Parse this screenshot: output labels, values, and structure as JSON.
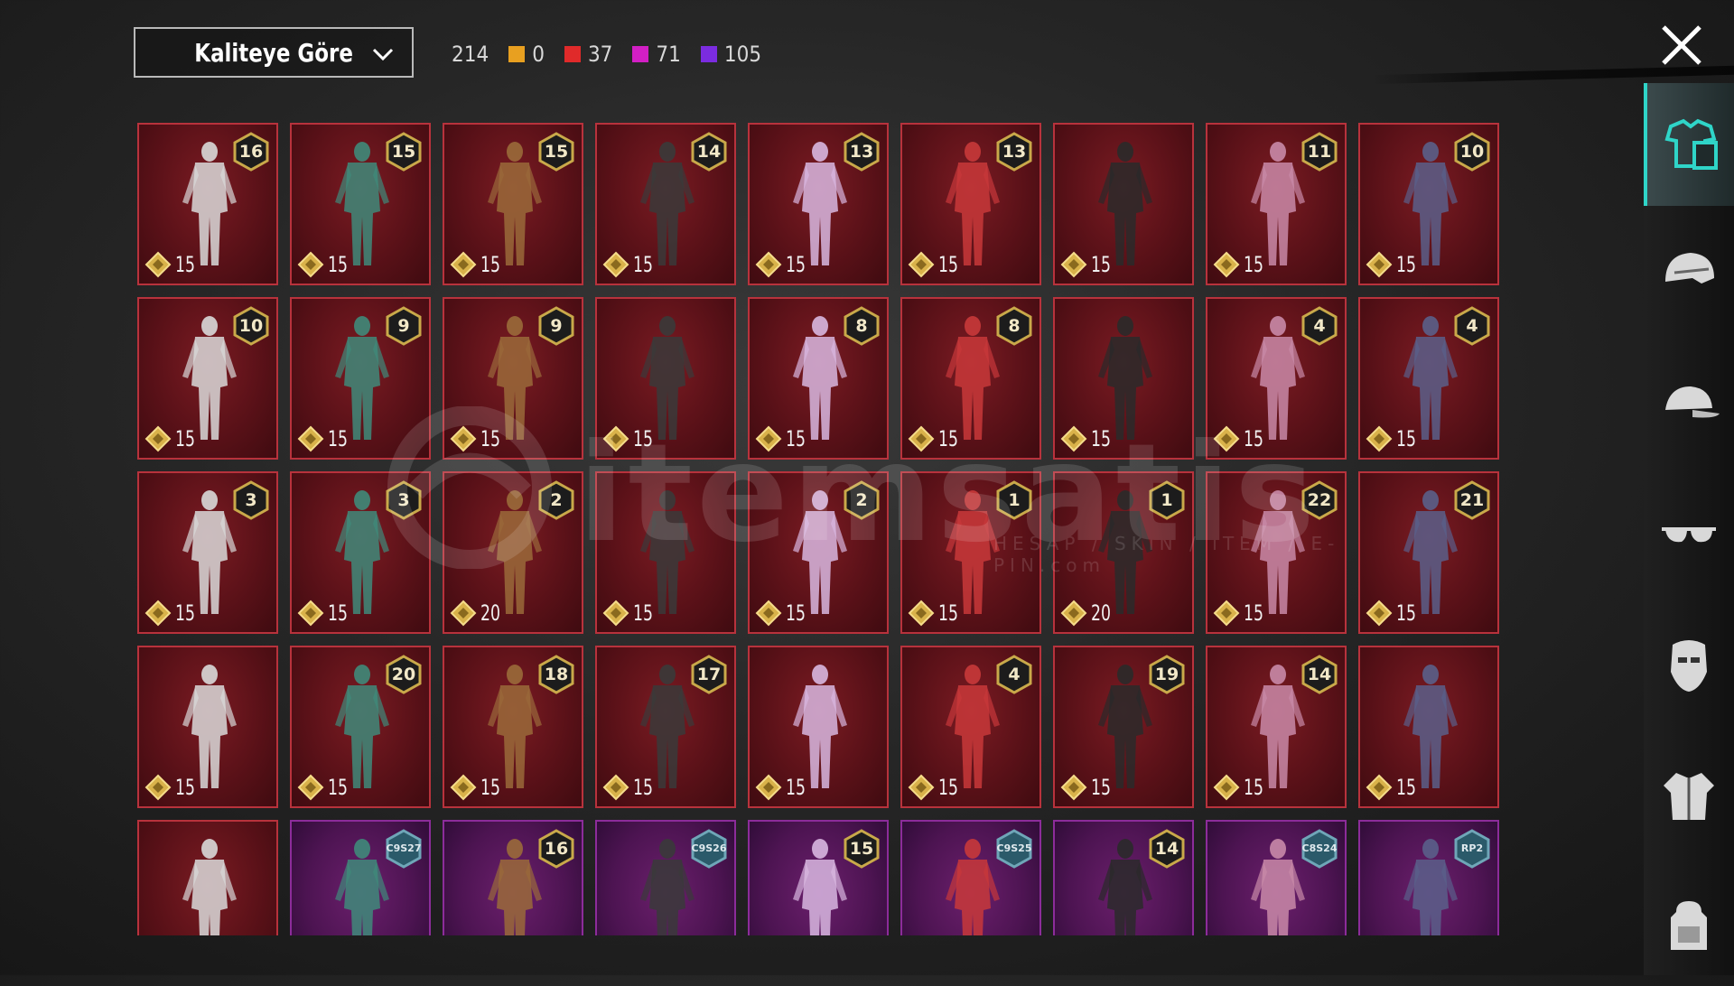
{
  "toolbar": {
    "sort_label": "Kaliteye Göre",
    "total": "214",
    "quality_counts": [
      {
        "name": "legendary-orange",
        "color": "#e8a020",
        "value": "0"
      },
      {
        "name": "mythic-red",
        "color": "#e02a2a",
        "value": "37"
      },
      {
        "name": "epic-magenta",
        "color": "#d21fc4",
        "value": "71"
      },
      {
        "name": "rare-violet",
        "color": "#7b2ce0",
        "value": "105"
      }
    ]
  },
  "colors": {
    "accent": "#2fd5c8",
    "card_border": "#b8323c",
    "card_border_purple": "#8c2c9a"
  },
  "watermark": {
    "text": "itemsatis",
    "sub": "HESAP / SKIN / ITEM / E-PIN",
    "domain": ".com"
  },
  "items": [
    {
      "badge": "16",
      "cost": "15"
    },
    {
      "badge": "15",
      "cost": "15"
    },
    {
      "badge": "15",
      "cost": "15"
    },
    {
      "badge": "14",
      "cost": "15"
    },
    {
      "badge": "13",
      "cost": "15"
    },
    {
      "badge": "13",
      "cost": "15"
    },
    {
      "badge": "",
      "cost": "15"
    },
    {
      "badge": "11",
      "cost": "15"
    },
    {
      "badge": "10",
      "cost": "15"
    },
    {
      "badge": "10",
      "cost": "15"
    },
    {
      "badge": "9",
      "cost": "15"
    },
    {
      "badge": "9",
      "cost": "15"
    },
    {
      "badge": "",
      "cost": "15"
    },
    {
      "badge": "8",
      "cost": "15"
    },
    {
      "badge": "8",
      "cost": "15"
    },
    {
      "badge": "",
      "cost": "15"
    },
    {
      "badge": "4",
      "cost": "15"
    },
    {
      "badge": "4",
      "cost": "15"
    },
    {
      "badge": "3",
      "cost": "15"
    },
    {
      "badge": "3",
      "cost": "15"
    },
    {
      "badge": "2",
      "cost": "20"
    },
    {
      "badge": "",
      "cost": "15"
    },
    {
      "badge": "2",
      "cost": "15"
    },
    {
      "badge": "1",
      "cost": "15"
    },
    {
      "badge": "1",
      "cost": "20"
    },
    {
      "badge": "22",
      "cost": "15"
    },
    {
      "badge": "21",
      "cost": "15"
    },
    {
      "badge": "",
      "cost": "15"
    },
    {
      "badge": "20",
      "cost": "15"
    },
    {
      "badge": "18",
      "cost": "15"
    },
    {
      "badge": "17",
      "cost": "15"
    },
    {
      "badge": "",
      "cost": "15"
    },
    {
      "badge": "4",
      "cost": "15"
    },
    {
      "badge": "19",
      "cost": "15"
    },
    {
      "badge": "14",
      "cost": "15"
    },
    {
      "badge": "",
      "cost": "15"
    },
    {
      "badge": "",
      "cost": ""
    },
    {
      "badge": "C9S27",
      "cost": ""
    },
    {
      "badge": "16",
      "cost": ""
    },
    {
      "badge": "C9S26",
      "cost": ""
    },
    {
      "badge": "15",
      "cost": ""
    },
    {
      "badge": "C9S25",
      "cost": ""
    },
    {
      "badge": "14",
      "cost": ""
    },
    {
      "badge": "C8S24",
      "cost": ""
    },
    {
      "badge": "RP2",
      "cost": ""
    }
  ],
  "sidebar": [
    {
      "name": "outfit-icon",
      "active": true
    },
    {
      "name": "helmet-icon",
      "active": false
    },
    {
      "name": "cap-icon",
      "active": false
    },
    {
      "name": "glasses-icon",
      "active": false
    },
    {
      "name": "mask-icon",
      "active": false
    },
    {
      "name": "jacket-icon",
      "active": false
    },
    {
      "name": "backpack-icon",
      "active": false
    }
  ]
}
